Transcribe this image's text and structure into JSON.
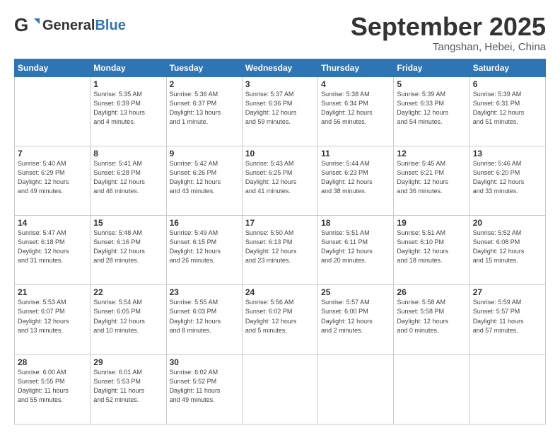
{
  "header": {
    "logo_general": "General",
    "logo_blue": "Blue",
    "month_title": "September 2025",
    "location": "Tangshan, Hebei, China"
  },
  "weekdays": [
    "Sunday",
    "Monday",
    "Tuesday",
    "Wednesday",
    "Thursday",
    "Friday",
    "Saturday"
  ],
  "weeks": [
    [
      {
        "day": "",
        "info": ""
      },
      {
        "day": "1",
        "info": "Sunrise: 5:35 AM\nSunset: 6:39 PM\nDaylight: 13 hours\nand 4 minutes."
      },
      {
        "day": "2",
        "info": "Sunrise: 5:36 AM\nSunset: 6:37 PM\nDaylight: 13 hours\nand 1 minute."
      },
      {
        "day": "3",
        "info": "Sunrise: 5:37 AM\nSunset: 6:36 PM\nDaylight: 12 hours\nand 59 minutes."
      },
      {
        "day": "4",
        "info": "Sunrise: 5:38 AM\nSunset: 6:34 PM\nDaylight: 12 hours\nand 56 minutes."
      },
      {
        "day": "5",
        "info": "Sunrise: 5:39 AM\nSunset: 6:33 PM\nDaylight: 12 hours\nand 54 minutes."
      },
      {
        "day": "6",
        "info": "Sunrise: 5:39 AM\nSunset: 6:31 PM\nDaylight: 12 hours\nand 51 minutes."
      }
    ],
    [
      {
        "day": "7",
        "info": "Sunrise: 5:40 AM\nSunset: 6:29 PM\nDaylight: 12 hours\nand 49 minutes."
      },
      {
        "day": "8",
        "info": "Sunrise: 5:41 AM\nSunset: 6:28 PM\nDaylight: 12 hours\nand 46 minutes."
      },
      {
        "day": "9",
        "info": "Sunrise: 5:42 AM\nSunset: 6:26 PM\nDaylight: 12 hours\nand 43 minutes."
      },
      {
        "day": "10",
        "info": "Sunrise: 5:43 AM\nSunset: 6:25 PM\nDaylight: 12 hours\nand 41 minutes."
      },
      {
        "day": "11",
        "info": "Sunrise: 5:44 AM\nSunset: 6:23 PM\nDaylight: 12 hours\nand 38 minutes."
      },
      {
        "day": "12",
        "info": "Sunrise: 5:45 AM\nSunset: 6:21 PM\nDaylight: 12 hours\nand 36 minutes."
      },
      {
        "day": "13",
        "info": "Sunrise: 5:46 AM\nSunset: 6:20 PM\nDaylight: 12 hours\nand 33 minutes."
      }
    ],
    [
      {
        "day": "14",
        "info": "Sunrise: 5:47 AM\nSunset: 6:18 PM\nDaylight: 12 hours\nand 31 minutes."
      },
      {
        "day": "15",
        "info": "Sunrise: 5:48 AM\nSunset: 6:16 PM\nDaylight: 12 hours\nand 28 minutes."
      },
      {
        "day": "16",
        "info": "Sunrise: 5:49 AM\nSunset: 6:15 PM\nDaylight: 12 hours\nand 26 minutes."
      },
      {
        "day": "17",
        "info": "Sunrise: 5:50 AM\nSunset: 6:13 PM\nDaylight: 12 hours\nand 23 minutes."
      },
      {
        "day": "18",
        "info": "Sunrise: 5:51 AM\nSunset: 6:11 PM\nDaylight: 12 hours\nand 20 minutes."
      },
      {
        "day": "19",
        "info": "Sunrise: 5:51 AM\nSunset: 6:10 PM\nDaylight: 12 hours\nand 18 minutes."
      },
      {
        "day": "20",
        "info": "Sunrise: 5:52 AM\nSunset: 6:08 PM\nDaylight: 12 hours\nand 15 minutes."
      }
    ],
    [
      {
        "day": "21",
        "info": "Sunrise: 5:53 AM\nSunset: 6:07 PM\nDaylight: 12 hours\nand 13 minutes."
      },
      {
        "day": "22",
        "info": "Sunrise: 5:54 AM\nSunset: 6:05 PM\nDaylight: 12 hours\nand 10 minutes."
      },
      {
        "day": "23",
        "info": "Sunrise: 5:55 AM\nSunset: 6:03 PM\nDaylight: 12 hours\nand 8 minutes."
      },
      {
        "day": "24",
        "info": "Sunrise: 5:56 AM\nSunset: 6:02 PM\nDaylight: 12 hours\nand 5 minutes."
      },
      {
        "day": "25",
        "info": "Sunrise: 5:57 AM\nSunset: 6:00 PM\nDaylight: 12 hours\nand 2 minutes."
      },
      {
        "day": "26",
        "info": "Sunrise: 5:58 AM\nSunset: 5:58 PM\nDaylight: 12 hours\nand 0 minutes."
      },
      {
        "day": "27",
        "info": "Sunrise: 5:59 AM\nSunset: 5:57 PM\nDaylight: 11 hours\nand 57 minutes."
      }
    ],
    [
      {
        "day": "28",
        "info": "Sunrise: 6:00 AM\nSunset: 5:55 PM\nDaylight: 11 hours\nand 55 minutes."
      },
      {
        "day": "29",
        "info": "Sunrise: 6:01 AM\nSunset: 5:53 PM\nDaylight: 11 hours\nand 52 minutes."
      },
      {
        "day": "30",
        "info": "Sunrise: 6:02 AM\nSunset: 5:52 PM\nDaylight: 11 hours\nand 49 minutes."
      },
      {
        "day": "",
        "info": ""
      },
      {
        "day": "",
        "info": ""
      },
      {
        "day": "",
        "info": ""
      },
      {
        "day": "",
        "info": ""
      }
    ]
  ]
}
